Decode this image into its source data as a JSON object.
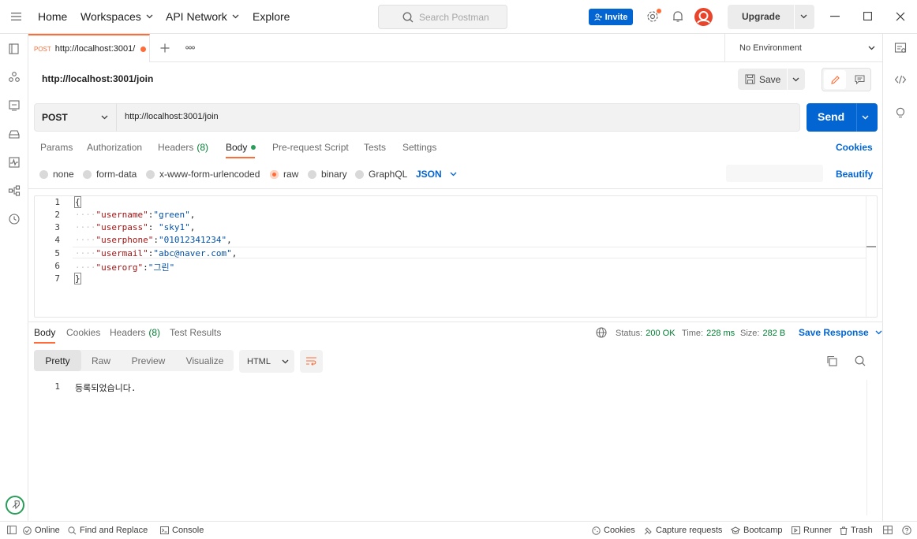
{
  "topbar": {
    "home": "Home",
    "workspaces": "Workspaces",
    "api_network": "API Network",
    "explore": "Explore",
    "search_placeholder": "Search Postman",
    "invite": "Invite",
    "upgrade": "Upgrade"
  },
  "tab": {
    "method": "POST",
    "url": "http://localhost:3001/",
    "environment": "No Environment"
  },
  "request": {
    "title": "http://localhost:3001/join",
    "save": "Save",
    "method": "POST",
    "url": "http://localhost:3001/join",
    "send": "Send",
    "tabs": [
      "Params",
      "Authorization",
      "Headers",
      "Body",
      "Pre-request Script",
      "Tests",
      "Settings"
    ],
    "headers_count": "(8)",
    "cookies": "Cookies",
    "body_types": [
      "none",
      "form-data",
      "x-www-form-urlencoded",
      "raw",
      "binary",
      "GraphQL"
    ],
    "body_format": "JSON",
    "beautify": "Beautify",
    "code_lines": [
      {
        "n": "1",
        "key": "",
        "val": "",
        "open": "{"
      },
      {
        "n": "2",
        "key": "\"username\"",
        "val": "\"green\"",
        "tail": ","
      },
      {
        "n": "3",
        "key": "\"userpass\"",
        "val": " \"sky1\"",
        "tail": ","
      },
      {
        "n": "4",
        "key": "\"userphone\"",
        "val": "\"01012341234\"",
        "tail": ","
      },
      {
        "n": "5",
        "key": "\"usermail\"",
        "val": "\"abc@naver.com\"",
        "tail": ","
      },
      {
        "n": "6",
        "key": "\"userorg\"",
        "val": "\"그린\"",
        "tail": ""
      },
      {
        "n": "7",
        "key": "",
        "val": "",
        "open": "}"
      }
    ]
  },
  "response": {
    "tabs": [
      "Body",
      "Cookies",
      "Headers",
      "Test Results"
    ],
    "headers_count": "(8)",
    "status_label": "Status:",
    "status_value": "200 OK",
    "time_label": "Time:",
    "time_value": "228 ms",
    "size_label": "Size:",
    "size_value": "282 B",
    "save_response": "Save Response",
    "views": [
      "Pretty",
      "Raw",
      "Preview",
      "Visualize"
    ],
    "format": "HTML",
    "body_line_no": "1",
    "body_text": "등록되었습니다."
  },
  "statusbar": {
    "online": "Online",
    "find_replace": "Find and Replace",
    "console": "Console",
    "cookies": "Cookies",
    "capture": "Capture requests",
    "bootcamp": "Bootcamp",
    "runner": "Runner",
    "trash": "Trash"
  },
  "colors": {
    "accent": "#ff6c37",
    "primary": "#0265d2",
    "success": "#007f31"
  }
}
